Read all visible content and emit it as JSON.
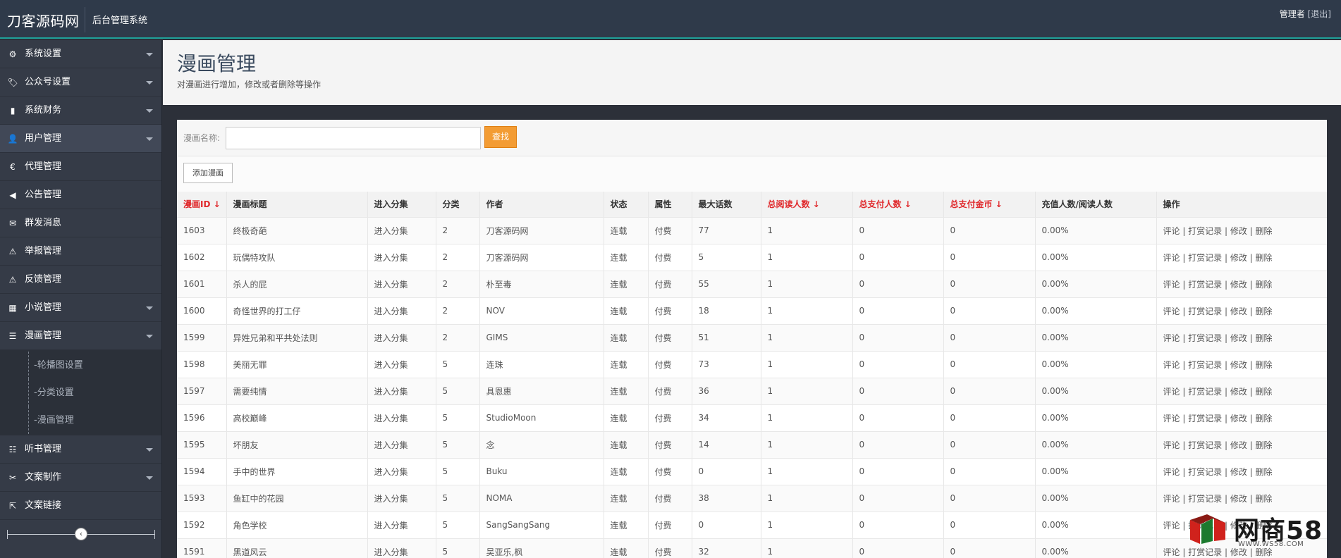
{
  "header": {
    "brand": "刀客源码网",
    "subtitle": "后台管理系统",
    "user": "管理者",
    "logout": "[退出]"
  },
  "sidebar": {
    "items": [
      {
        "label": "系统设置",
        "icon": "gear-icon",
        "glyph": "⚙",
        "caret": true
      },
      {
        "label": "公众号设置",
        "icon": "tags-icon",
        "glyph": "🏷",
        "caret": true
      },
      {
        "label": "系统财务",
        "icon": "bar-chart-icon",
        "glyph": "▮",
        "caret": true
      },
      {
        "label": "用户管理",
        "icon": "user-icon",
        "glyph": "👤",
        "caret": true,
        "active": true
      },
      {
        "label": "代理管理",
        "icon": "euro-icon",
        "glyph": "€",
        "caret": false
      },
      {
        "label": "公告管理",
        "icon": "bullhorn-icon",
        "glyph": "◀",
        "caret": false
      },
      {
        "label": "群发消息",
        "icon": "envelope-icon",
        "glyph": "✉",
        "caret": false
      },
      {
        "label": "举报管理",
        "icon": "warning-icon",
        "glyph": "⚠",
        "caret": false
      },
      {
        "label": "反馈管理",
        "icon": "warning-icon",
        "glyph": "⚠",
        "caret": false
      },
      {
        "label": "小说管理",
        "icon": "grid-icon",
        "glyph": "▦",
        "caret": true
      },
      {
        "label": "漫画管理",
        "icon": "list-icon",
        "glyph": "☰",
        "caret": true
      }
    ],
    "subitems": [
      "-轮播图设置",
      "-分类设置",
      "-漫画管理"
    ],
    "items_after": [
      {
        "label": "听书管理",
        "icon": "sliders-icon",
        "glyph": "☷",
        "caret": true
      },
      {
        "label": "文案制作",
        "icon": "wrench-icon",
        "glyph": "✂",
        "caret": true
      },
      {
        "label": "文案链接",
        "icon": "external-link-icon",
        "glyph": "⇱",
        "caret": false
      }
    ],
    "collapse_glyph": "‹"
  },
  "page": {
    "title": "漫画管理",
    "description": "对漫画进行增加，修改或者删除等操作"
  },
  "search": {
    "label": "漫画名称:",
    "placeholder": "",
    "button": "查找"
  },
  "toolbar": {
    "add_label": "添加漫画"
  },
  "table": {
    "columns": [
      {
        "label": "漫画ID ↓",
        "sortable": true
      },
      {
        "label": "漫画标题",
        "sortable": false
      },
      {
        "label": "进入分集",
        "sortable": false
      },
      {
        "label": "分类",
        "sortable": false
      },
      {
        "label": "作者",
        "sortable": false
      },
      {
        "label": "状态",
        "sortable": false
      },
      {
        "label": "属性",
        "sortable": false
      },
      {
        "label": "最大话数",
        "sortable": false
      },
      {
        "label": "总阅读人数 ↓",
        "sortable": true
      },
      {
        "label": "总支付人数 ↓",
        "sortable": true
      },
      {
        "label": "总支付金币 ↓",
        "sortable": true
      },
      {
        "label": "充值人数/阅读人数",
        "sortable": false
      },
      {
        "label": "操作",
        "sortable": false
      }
    ],
    "rows": [
      [
        "1603",
        "终极奇葩",
        "进入分集",
        "2",
        "刀客源码网",
        "连载",
        "付费",
        "77",
        "1",
        "0",
        "0",
        "0.00%",
        "评论 | 打赏记录 | 修改 | 删除"
      ],
      [
        "1602",
        "玩偶特攻队",
        "进入分集",
        "2",
        "刀客源码网",
        "连载",
        "付费",
        "5",
        "1",
        "0",
        "0",
        "0.00%",
        "评论 | 打赏记录 | 修改 | 删除"
      ],
      [
        "1601",
        "杀人的屁",
        "进入分集",
        "2",
        "朴至毒",
        "连载",
        "付费",
        "55",
        "1",
        "0",
        "0",
        "0.00%",
        "评论 | 打赏记录 | 修改 | 删除"
      ],
      [
        "1600",
        "奇怪世界的打工仔",
        "进入分集",
        "2",
        "NOV",
        "连载",
        "付费",
        "18",
        "1",
        "0",
        "0",
        "0.00%",
        "评论 | 打赏记录 | 修改 | 删除"
      ],
      [
        "1599",
        "异姓兄弟和平共处法则",
        "进入分集",
        "2",
        "GIMS",
        "连载",
        "付费",
        "51",
        "1",
        "0",
        "0",
        "0.00%",
        "评论 | 打赏记录 | 修改 | 删除"
      ],
      [
        "1598",
        "美丽无罪",
        "进入分集",
        "5",
        "连珠",
        "连载",
        "付费",
        "73",
        "1",
        "0",
        "0",
        "0.00%",
        "评论 | 打赏记录 | 修改 | 删除"
      ],
      [
        "1597",
        "需要纯情",
        "进入分集",
        "5",
        "具恩惠",
        "连载",
        "付费",
        "36",
        "1",
        "0",
        "0",
        "0.00%",
        "评论 | 打赏记录 | 修改 | 删除"
      ],
      [
        "1596",
        "高校巅峰",
        "进入分集",
        "5",
        "StudioMoon",
        "连载",
        "付费",
        "34",
        "1",
        "0",
        "0",
        "0.00%",
        "评论 | 打赏记录 | 修改 | 删除"
      ],
      [
        "1595",
        "坏朋友",
        "进入分集",
        "5",
        "念",
        "连载",
        "付费",
        "14",
        "1",
        "0",
        "0",
        "0.00%",
        "评论 | 打赏记录 | 修改 | 删除"
      ],
      [
        "1594",
        "手中的世界",
        "进入分集",
        "5",
        "Buku",
        "连载",
        "付费",
        "0",
        "1",
        "0",
        "0",
        "0.00%",
        "评论 | 打赏记录 | 修改 | 删除"
      ],
      [
        "1593",
        "鱼缸中的花园",
        "进入分集",
        "5",
        "NOMA",
        "连载",
        "付费",
        "38",
        "1",
        "0",
        "0",
        "0.00%",
        "评论 | 打赏记录 | 修改 | 删除"
      ],
      [
        "1592",
        "角色学校",
        "进入分集",
        "5",
        "SangSangSang",
        "连载",
        "付费",
        "0",
        "1",
        "0",
        "0",
        "0.00%",
        "评论 | 打赏记录 | 修改 | 删除"
      ],
      [
        "1591",
        "黑道风云",
        "进入分集",
        "5",
        "吴亚乐,枫",
        "连载",
        "付费",
        "32",
        "1",
        "0",
        "0",
        "0.00%",
        "评论 | 打赏记录 | 修改 | 删除"
      ]
    ]
  },
  "watermark": {
    "text": "网商58",
    "url": "WWW.WS58.COM"
  },
  "colors": {
    "topbar": "#2f3a4a",
    "accent_line": "#1fa29a",
    "sidebar": "#353b47",
    "search_button": "#f39c33",
    "sort_header": "#e0292c"
  }
}
